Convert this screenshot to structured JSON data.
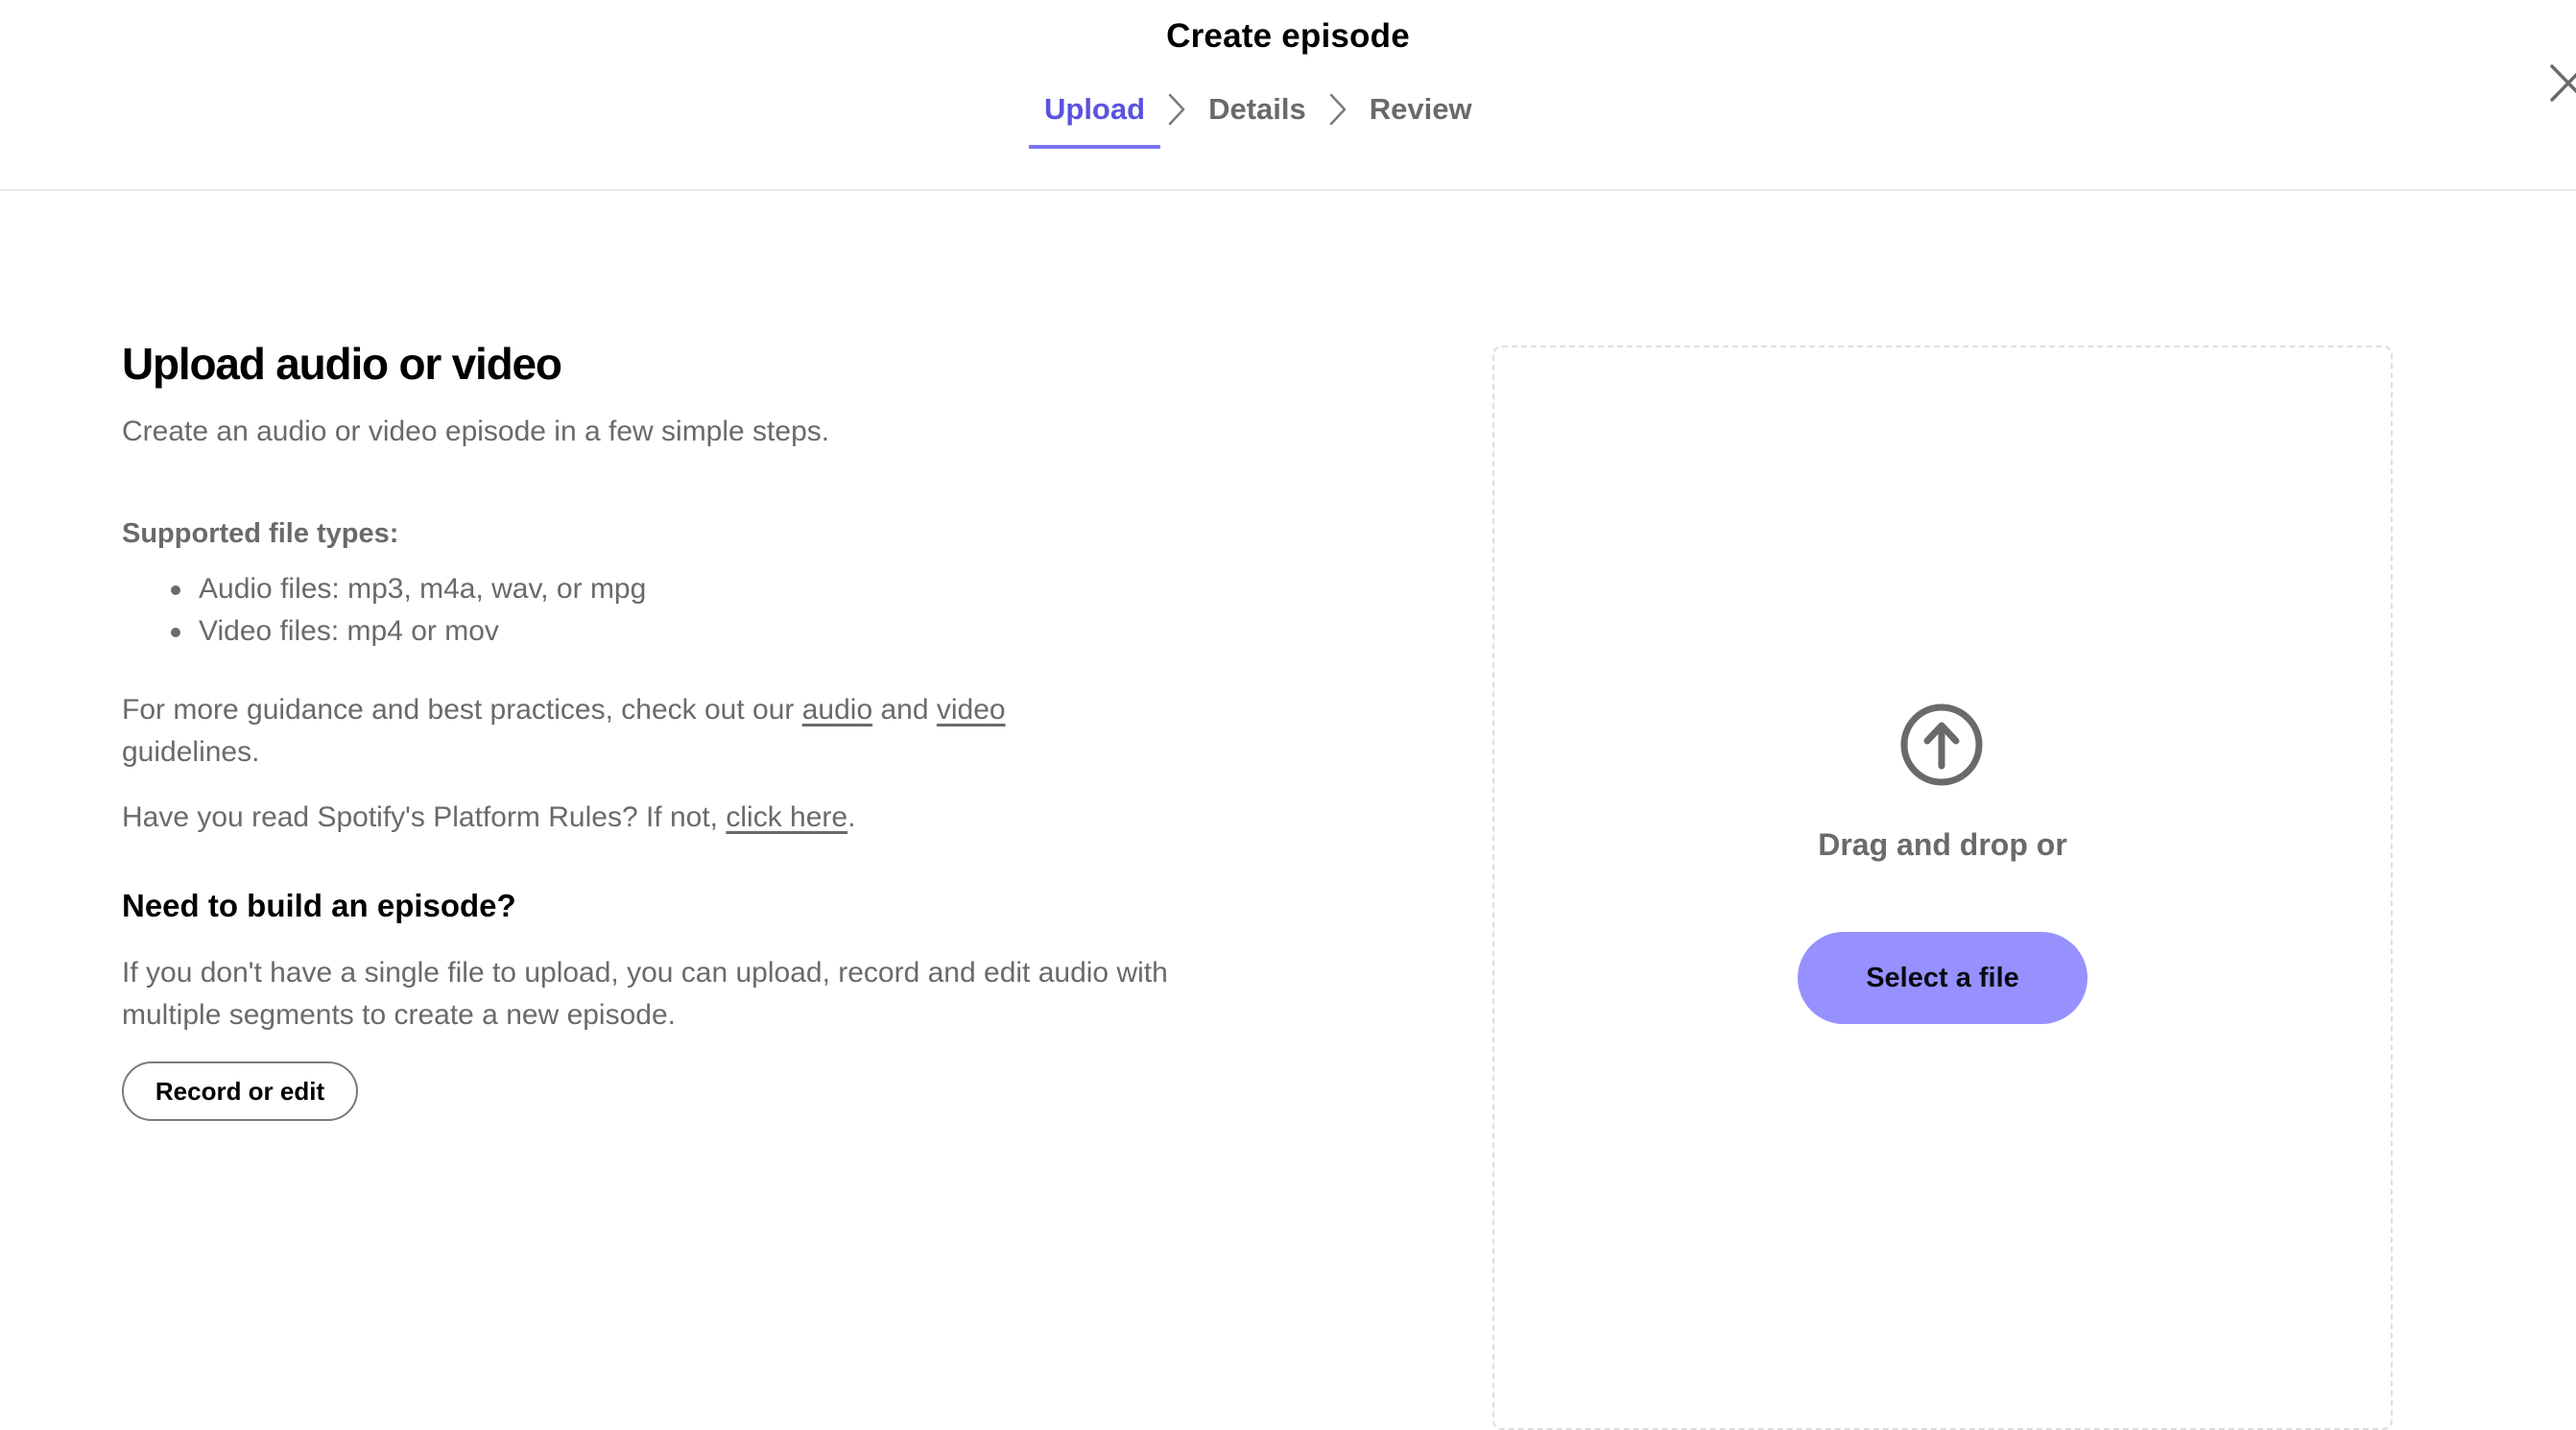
{
  "header": {
    "title": "Create episode",
    "steps": [
      {
        "label": "Upload",
        "active": true
      },
      {
        "label": "Details",
        "active": false
      },
      {
        "label": "Review",
        "active": false
      }
    ],
    "close_icon": "close-icon"
  },
  "main": {
    "heading": "Upload audio or video",
    "subtitle": "Create an audio or video episode in a few simple steps.",
    "supported_label": "Supported file types:",
    "file_types": [
      "Audio files: mp3, m4a, wav, or mpg",
      "Video files: mp4 or mov"
    ],
    "guidance": {
      "prefix": "For more guidance and best practices, check out our ",
      "audio_link": "audio",
      "middle": " and ",
      "video_link": "video",
      "suffix": " guidelines."
    },
    "rules": {
      "prefix": "Have you read Spotify's Platform Rules? If not, ",
      "link": "click here",
      "suffix": "."
    },
    "build_heading": "Need to build an episode?",
    "build_text": "If you don't have a single file to upload, you can upload, record and edit audio with multiple segments to create a new episode.",
    "record_button": "Record or edit"
  },
  "dropzone": {
    "icon": "upload-arrow-icon",
    "text": "Drag and drop or",
    "select_button": "Select a file"
  },
  "colors": {
    "accent": "#5a52e0",
    "tab_underline": "#7b74f2",
    "select_button_bg": "#9691ff",
    "muted_text": "#6a6a6a"
  }
}
